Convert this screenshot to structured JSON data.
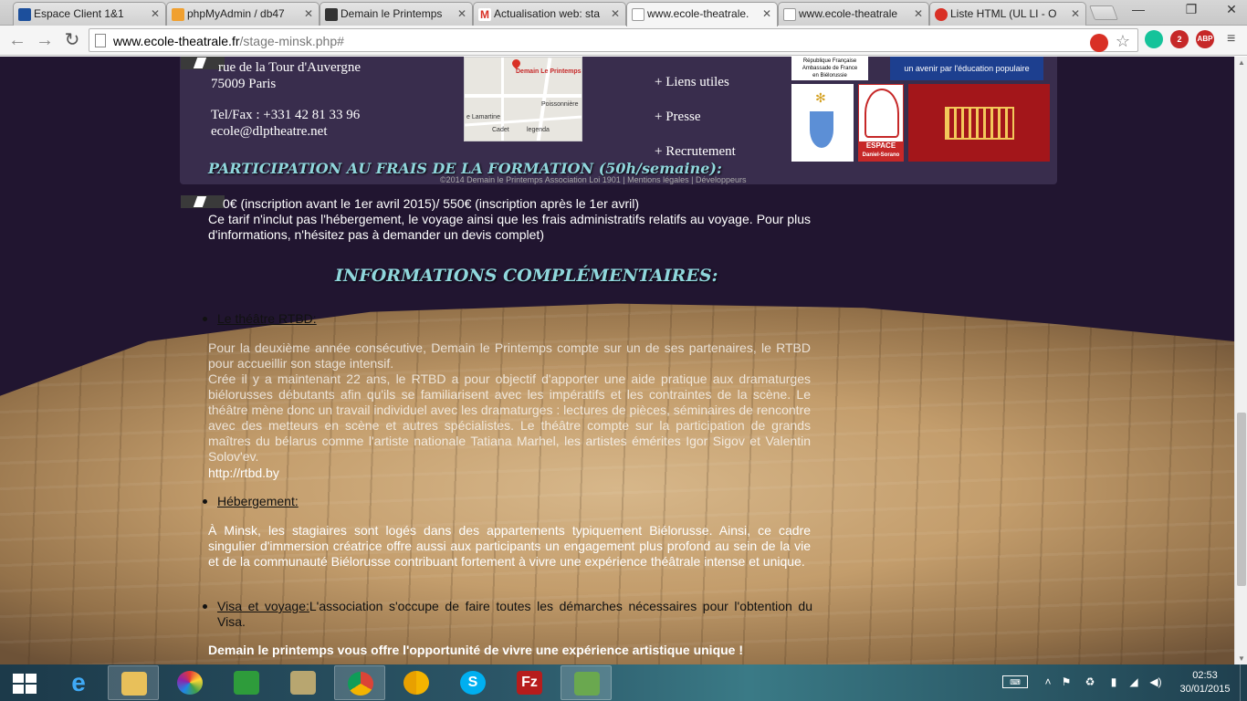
{
  "browser": {
    "tabs": [
      {
        "label": "Espace Client 1&1",
        "favicon_color": "#1c4f9c"
      },
      {
        "label": "phpMyAdmin / db47",
        "favicon_color": "#f0a030"
      },
      {
        "label": "Demain le Printemps",
        "favicon_color": "#333333"
      },
      {
        "label": "Actualisation web: sta",
        "favicon_color": "#d93025"
      },
      {
        "label": "www.ecole-theatrale.",
        "favicon_color": "#cccccc"
      },
      {
        "label": "www.ecole-theatrale",
        "favicon_color": "#cccccc"
      },
      {
        "label": "Liste HTML (UL LI - O",
        "favicon_color": "#d93025"
      }
    ],
    "active_tab": 4,
    "url_domain": "www.ecole-theatrale.fr",
    "url_path": "/stage-minsk.php#",
    "extensions": [
      {
        "name": "lastpass-icon",
        "label": "",
        "color": "#d93025"
      },
      {
        "name": "grammarly-icon",
        "label": "",
        "color": "#15c39a"
      },
      {
        "name": "extension-2-icon",
        "label": "2",
        "color": "#c62828"
      },
      {
        "name": "adblock-plus-icon",
        "label": "ABP",
        "color": "#c62828"
      }
    ]
  },
  "footer": {
    "address_line1": "rue de la Tour d'Auvergne",
    "address_line2": "75009 Paris",
    "telfax": "Tel/Fax : +331 42 81 33 96",
    "email": "ecole@dlptheatre.net",
    "map_pin_label": "Demain Le Printemps",
    "map_labels": [
      "Poissonnière",
      "e Lamartine",
      "Cadet",
      "legenda"
    ],
    "links": [
      "+ Liens utiles",
      "+ Presse",
      "+ Recrutement"
    ],
    "logo_rf_line1": "République Française",
    "logo_rf_line2": "Ambassade de France",
    "logo_rf_line3": "en Biélorussie",
    "logo_avenir": "un avenir par l'éducation populaire",
    "logo_espace_line1": "ESPACE",
    "logo_espace_line2": "Daniel-Sorano",
    "copyright": "©2014 Demain le Printemps Association Loi 1901 | Mentions légales | Développeurs"
  },
  "content": {
    "heading_participation": "PARTICIPATION AU FRAIS DE LA FORMATION (50h/semaine):",
    "price_line": "0€ (inscription avant le 1er avril 2015)/ 550€ (inscription après le 1er avril)",
    "price_note": "Ce tarif n'inclut pas l'hébergement, le voyage ainsi que les frais administratifs relatifs au voyage. Pour plus d'informations, n'hésitez pas à demander un devis complet)",
    "heading_info": "INFORMATIONS COMPLÉMENTAIRES:",
    "bullets": [
      {
        "title": "Le théâtre RTBD:",
        "rest": ""
      },
      {
        "title": "Hébergement:",
        "rest": ""
      },
      {
        "title": "Visa et voyage:",
        "rest": "L'association s'occupe de faire toutes les démarches nécessaires pour l'obtention du Visa."
      }
    ],
    "rtbd_p1": "Pour la deuxième année consécutive, Demain le Printemps compte sur un de ses partenaires, le RTBD pour accueillir son stage intensif.",
    "rtbd_p2": "Crée il y a maintenant 22 ans, le RTBD a pour objectif d'apporter une aide pratique aux dramaturges biélorusses débutants afin qu'ils se familiarisent avec les impératifs et les contraintes de la scène. Le théâtre mène donc un travail individuel avec les dramaturges : lectures de pièces, séminaires de rencontre avec des metteurs en scène et autres spécialistes. Le théâtre compte sur la participation de grands maîtres du bélarus comme l'artiste nationale Tatiana Marhel, les artistes émérites Igor Sigov et Valentin Solov'ev.",
    "rtbd_url": "http://rtbd.by",
    "hebergement_text": "À Minsk, les stagiaires sont logés dans des appartements typiquement Biélorusse. Ainsi, ce cadre singulier d'immersion créatrice offre aussi aux participants un engagement plus profond au sein de la vie et de la communauté Biélorusse contribuant fortement à vivre une expérience théâtrale intense et unique.",
    "closing": "Demain le printemps vous offre l'opportunité de vivre une expérience artistique unique !"
  },
  "taskbar": {
    "apps": [
      {
        "name": "file-explorer-icon",
        "color": "#e8c05a",
        "active": true
      },
      {
        "name": "picasa-icon",
        "color": "#8bc34a",
        "active": false
      },
      {
        "name": "store-icon",
        "color": "#2e9c3b",
        "active": false
      },
      {
        "name": "notepad-icon",
        "color": "#b8a670",
        "active": false
      },
      {
        "name": "chrome-icon",
        "color": "#4caf50",
        "active": true
      },
      {
        "name": "chrome-canary-icon",
        "color": "#f4b400",
        "active": false
      },
      {
        "name": "skype-icon",
        "color": "#00aff0",
        "active": false
      },
      {
        "name": "filezilla-icon",
        "color": "#b71c1c",
        "active": false
      },
      {
        "name": "notepad-plus-icon",
        "color": "#6aa84f",
        "active": false
      }
    ],
    "time": "02:53",
    "date": "30/01/2015"
  }
}
